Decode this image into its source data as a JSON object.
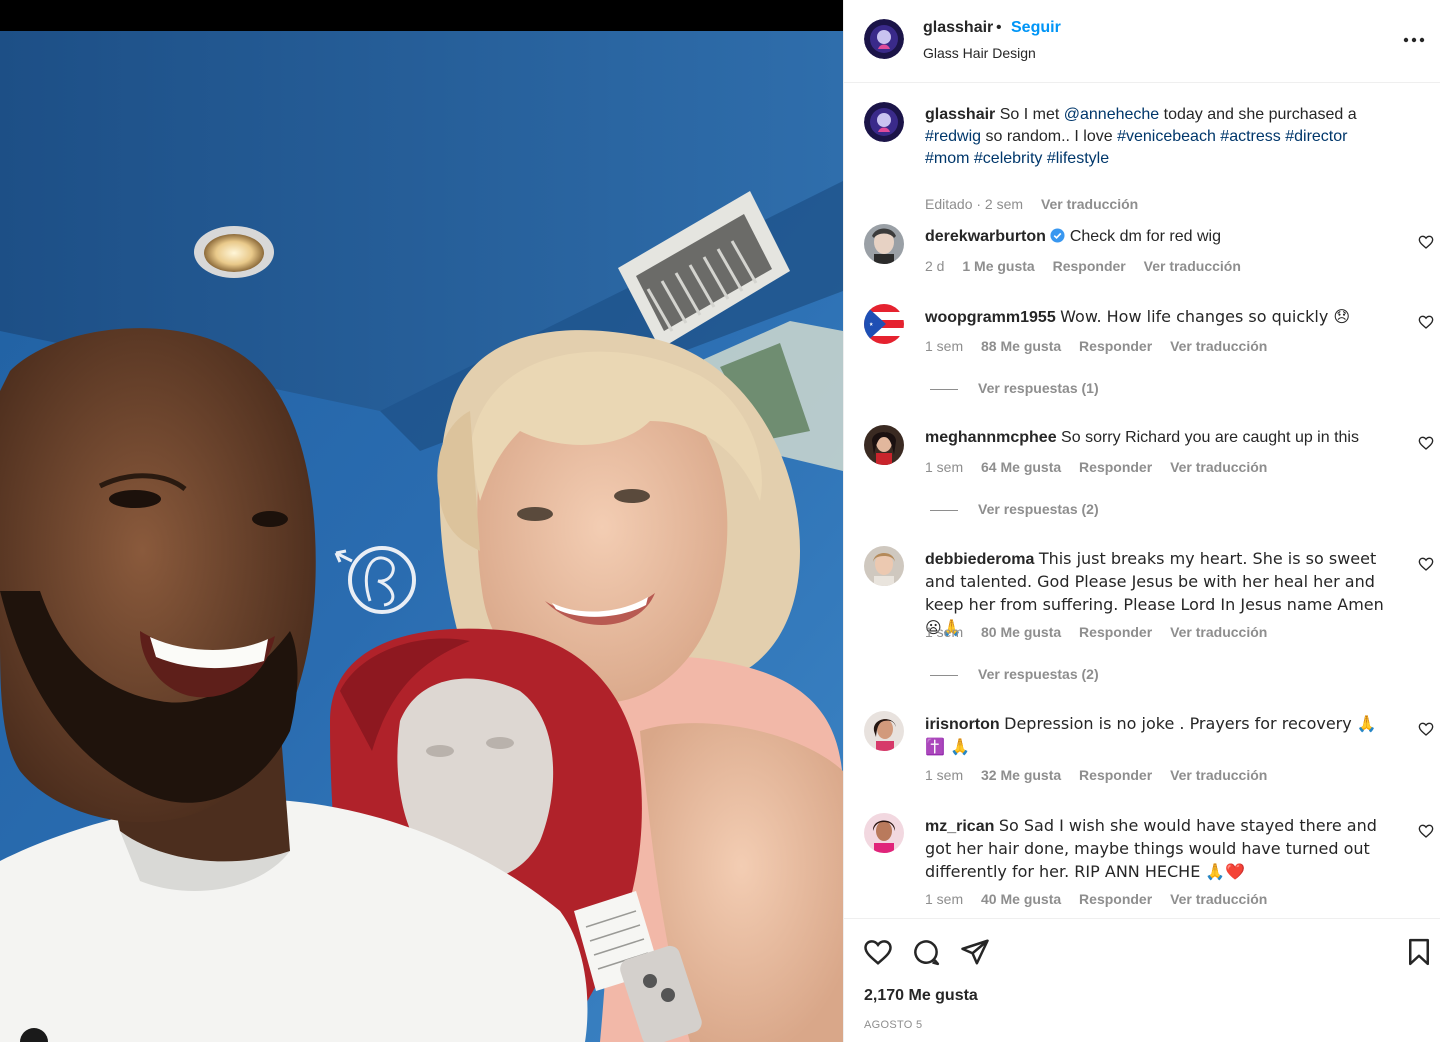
{
  "post": {
    "username": "glasshair",
    "dot": "•",
    "follow_label": "Seguir",
    "subtitle": "Glass Hair Design",
    "more_icon": "more-options-icon"
  },
  "caption": {
    "username": "glasshair",
    "parts": [
      "So I met ",
      "@anneheche",
      " today and she purchased a ",
      "#redwig",
      " so random.. I love ",
      "#venicebeach",
      " ",
      "#actress",
      " ",
      "#director",
      " ",
      "#mom",
      " ",
      "#celebrity",
      " ",
      "#lifestyle"
    ],
    "edited": "Editado · 2 sem",
    "translate": "Ver traducción"
  },
  "comments": [
    {
      "username": "derekwarburton",
      "verified": true,
      "text": "Check dm for red wig",
      "time": "2 d",
      "likes": "1 Me gusta",
      "reply": "Responder",
      "translate": "Ver traducción",
      "replies": ""
    },
    {
      "username": "woopgramm1955",
      "text": "Wow. How life changes so quickly 😞",
      "time": "1 sem",
      "likes": "88 Me gusta",
      "reply": "Responder",
      "translate": "Ver traducción",
      "replies": "Ver respuestas (1)"
    },
    {
      "username": "meghannmcphee",
      "text": "So sorry Richard you are caught up in this",
      "time": "1 sem",
      "likes": "64 Me gusta",
      "reply": "Responder",
      "translate": "Ver traducción",
      "replies": "Ver respuestas (2)"
    },
    {
      "username": "debbiederoma",
      "text": "This just breaks my heart. She is so sweet and talented. God Please Jesus be with her heal her and keep her from suffering. Please Lord In Jesus name Amen 😦🙏",
      "time": "1 sem",
      "likes": "80 Me gusta",
      "reply": "Responder",
      "translate": "Ver traducción",
      "replies": "Ver respuestas (2)"
    },
    {
      "username": "irisnorton",
      "text": "Depression is no joke . Prayers for recovery 🙏✝️ 🙏",
      "time": "1 sem",
      "likes": "32 Me gusta",
      "reply": "Responder",
      "translate": "Ver traducción",
      "replies": ""
    },
    {
      "username": "mz_rican",
      "text": "So Sad I wish she would have stayed there and got her hair done, maybe things would have turned out differently for her. RIP ANN HECHE 🙏❤️",
      "time": "1 sem",
      "likes": "40 Me gusta",
      "reply": "Responder",
      "translate": "Ver traducción",
      "replies": ""
    }
  ],
  "footer": {
    "likes": "2,170 Me gusta",
    "date": "AGOSTO 5"
  },
  "colors": {
    "accent": "#0095f6",
    "hashtag": "#00376b",
    "muted": "#8e8e8e",
    "verified": "#3897f0"
  }
}
